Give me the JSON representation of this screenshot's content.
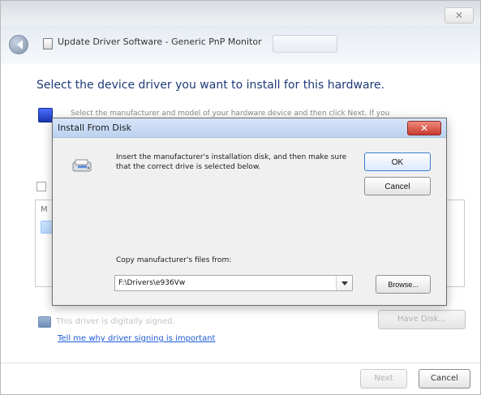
{
  "outer": {
    "window_title": "Update Driver Software - Generic PnP Monitor",
    "close_glyph": "✕",
    "main_heading": "Select the device driver you want to install for this hardware.",
    "instruction_text": "Select the manufacturer and model of your hardware device and then click Next. If you",
    "list_label": "M",
    "driver_status": "This driver is digitally signed.",
    "have_disk_label": "Have Disk...",
    "help_link": "Tell me why driver signing is important",
    "next_label": "Next",
    "cancel_label": "Cancel"
  },
  "modal": {
    "title": "Install From Disk",
    "close_glyph": "✕",
    "message": "Insert the manufacturer's installation disk, and then make sure that the correct drive is selected below.",
    "ok_label": "OK",
    "cancel_label": "Cancel",
    "copy_label": "Copy manufacturer's files from:",
    "path_value": "F:\\Drivers\\e936Vw",
    "browse_label": "Browse..."
  },
  "colors": {
    "heading_blue": "#1f3a78",
    "close_red": "#c73b2f",
    "ok_border": "#3b7fd3"
  }
}
